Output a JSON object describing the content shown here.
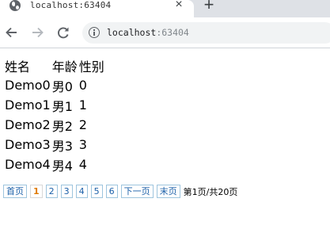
{
  "browser": {
    "tab_title": "localhost:63404",
    "tab_close": "×",
    "new_tab": "+",
    "url_host": "localhost",
    "url_port": ":63404"
  },
  "table": {
    "headers": [
      "姓名",
      "年龄",
      "性别"
    ],
    "rows": [
      [
        "Demo0",
        "男0",
        "0"
      ],
      [
        "Demo1",
        "男1",
        "1"
      ],
      [
        "Demo2",
        "男2",
        "2"
      ],
      [
        "Demo3",
        "男3",
        "3"
      ],
      [
        "Demo4",
        "男4",
        "4"
      ]
    ]
  },
  "pager": {
    "first": "首页",
    "pages": [
      "1",
      "2",
      "3",
      "4",
      "5",
      "6"
    ],
    "next": "下一页",
    "last": "末页",
    "info": "第1页/共20页"
  }
}
